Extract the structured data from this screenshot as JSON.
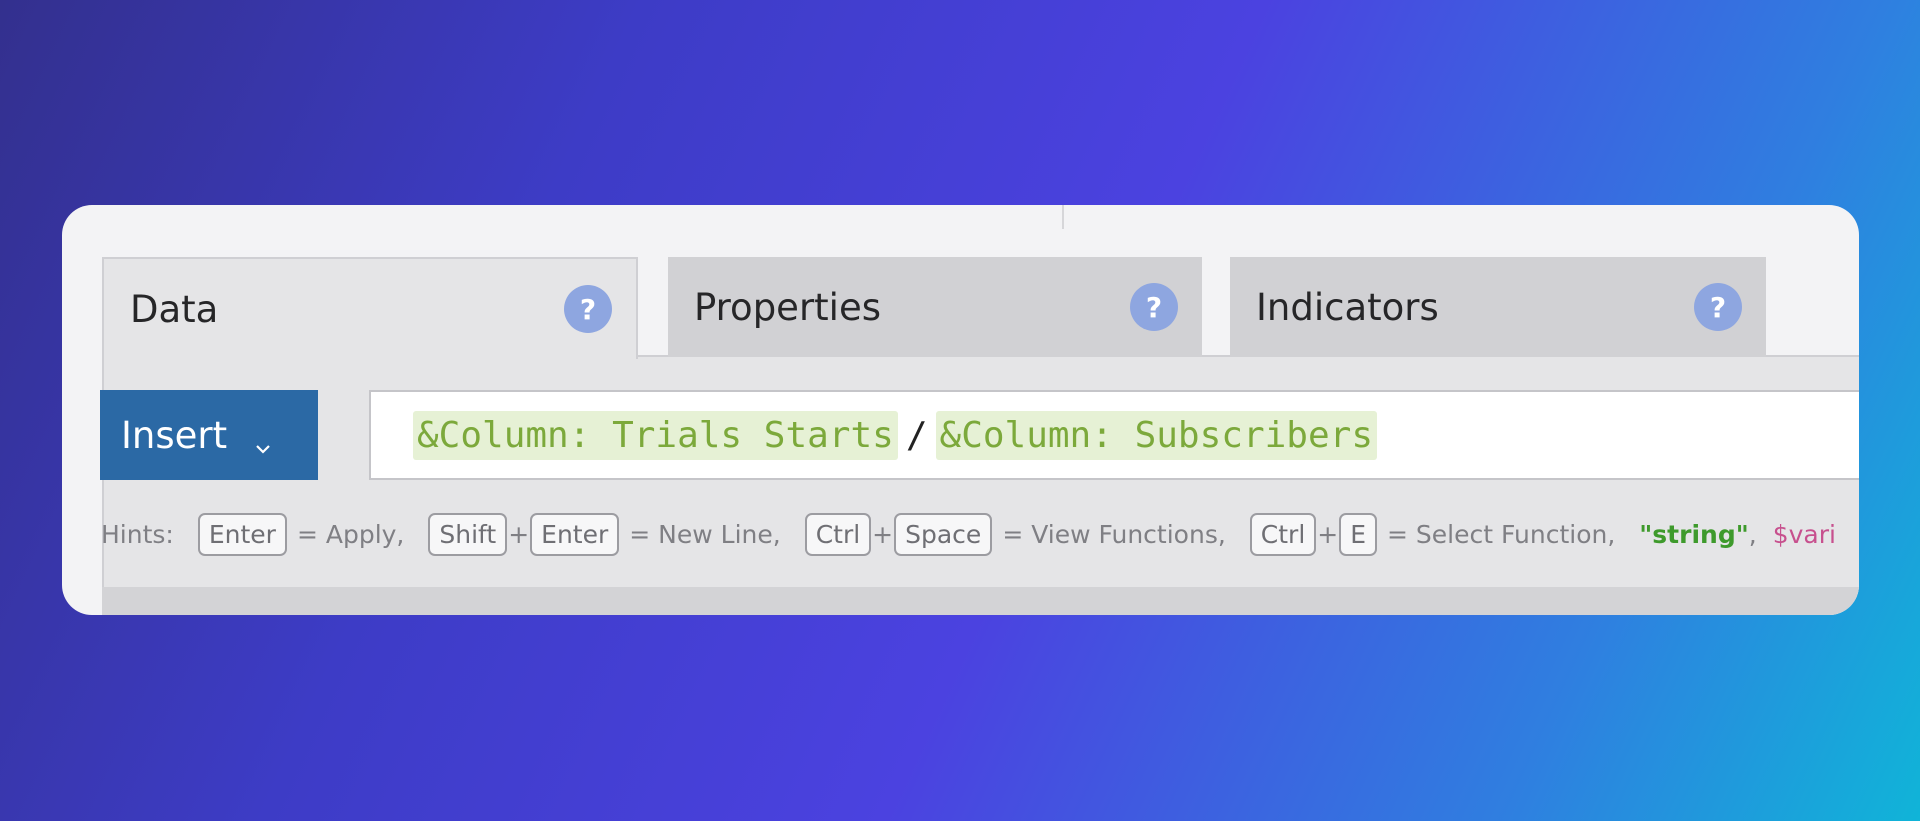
{
  "tabs": [
    {
      "label": "Data",
      "help": "?"
    },
    {
      "label": "Properties",
      "help": "?"
    },
    {
      "label": "Indicators",
      "help": "?"
    }
  ],
  "insert": {
    "label": "Insert"
  },
  "formula": {
    "token1": "&Column: Trials Starts",
    "operator": "/",
    "token2": "&Column: Subscribers"
  },
  "hints": {
    "prefix": "Hints:",
    "key_enter": "Enter",
    "apply": "= Apply,",
    "key_shift": "Shift",
    "plus": "+",
    "new_line": "= New Line,",
    "key_ctrl": "Ctrl",
    "key_space": "Space",
    "view_functions": "= View Functions,",
    "key_e": "E",
    "select_function": "= Select Function,",
    "string_hint": "\"string\"",
    "comma": ",",
    "var_hint": "$vari"
  },
  "colors": {
    "accent": "#2b69a5",
    "token_bg": "#e6f1d5",
    "token_text": "#7ca93b",
    "help_icon": "#8ea6e0"
  }
}
